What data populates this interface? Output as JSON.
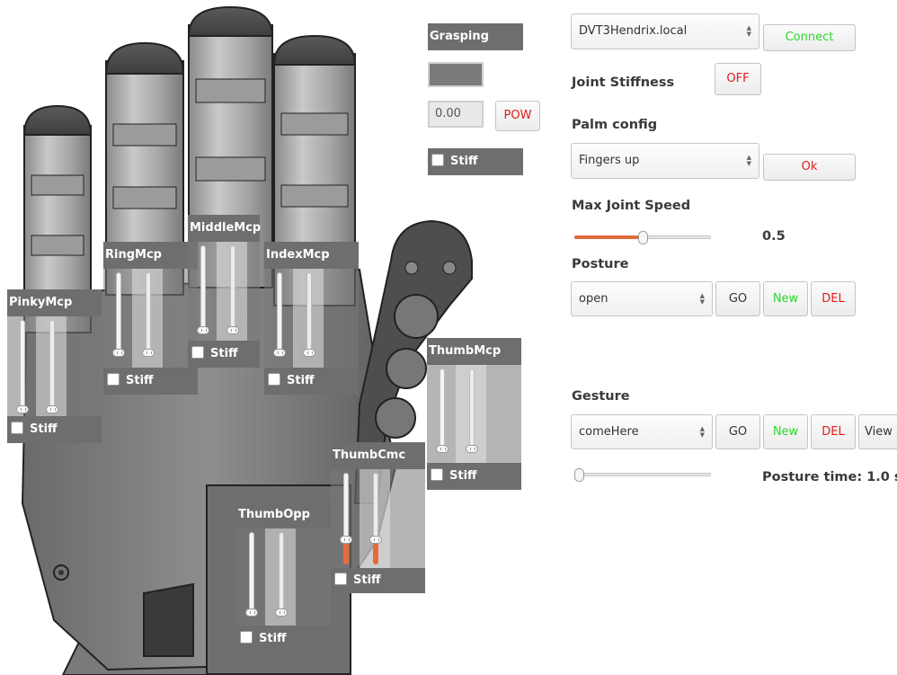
{
  "grasp": {
    "title": "Grasping",
    "value": "0.00",
    "pow_label": "POW",
    "stiff_label": "Stiff"
  },
  "joints": [
    {
      "name": "PinkyMcp",
      "stiff_label": "Stiff",
      "levels": [
        0,
        0
      ]
    },
    {
      "name": "RingMcp",
      "stiff_label": "Stiff",
      "levels": [
        0,
        0
      ]
    },
    {
      "name": "MiddleMcp",
      "stiff_label": "Stiff",
      "levels": [
        0,
        0
      ]
    },
    {
      "name": "IndexMcp",
      "stiff_label": "Stiff",
      "levels": [
        0,
        0
      ]
    },
    {
      "name": "ThumbMcp",
      "stiff_label": "Stiff",
      "levels": [
        0,
        0
      ]
    },
    {
      "name": "ThumbCmc",
      "stiff_label": "Stiff",
      "levels": [
        0.25,
        0.25
      ]
    },
    {
      "name": "ThumbOpp",
      "stiff_label": "Stiff",
      "levels": [
        0,
        0
      ]
    }
  ],
  "connection": {
    "host": "DVT3Hendrix.local",
    "connect_label": "Connect"
  },
  "joint_stiffness": {
    "label": "Joint Stiffness",
    "toggle_label": "OFF"
  },
  "palm_config": {
    "label": "Palm config",
    "selected": "Fingers up",
    "ok_label": "Ok"
  },
  "max_speed": {
    "label": "Max Joint Speed",
    "value": "0.5",
    "level": 0.5
  },
  "posture": {
    "label": "Posture",
    "selected": "open",
    "go_label": "GO",
    "new_label": "New",
    "del_label": "DEL"
  },
  "gesture": {
    "label": "Gesture",
    "selected": "comeHere",
    "go_label": "GO",
    "new_label": "New",
    "del_label": "DEL",
    "view_label": "View",
    "time_label": "Posture time: 1.0 s",
    "level": 0.0
  },
  "colors": {
    "accent": "#e06a3c",
    "green": "#2ad72a",
    "red": "#e31a1a",
    "panel": "#6e6e6e"
  }
}
